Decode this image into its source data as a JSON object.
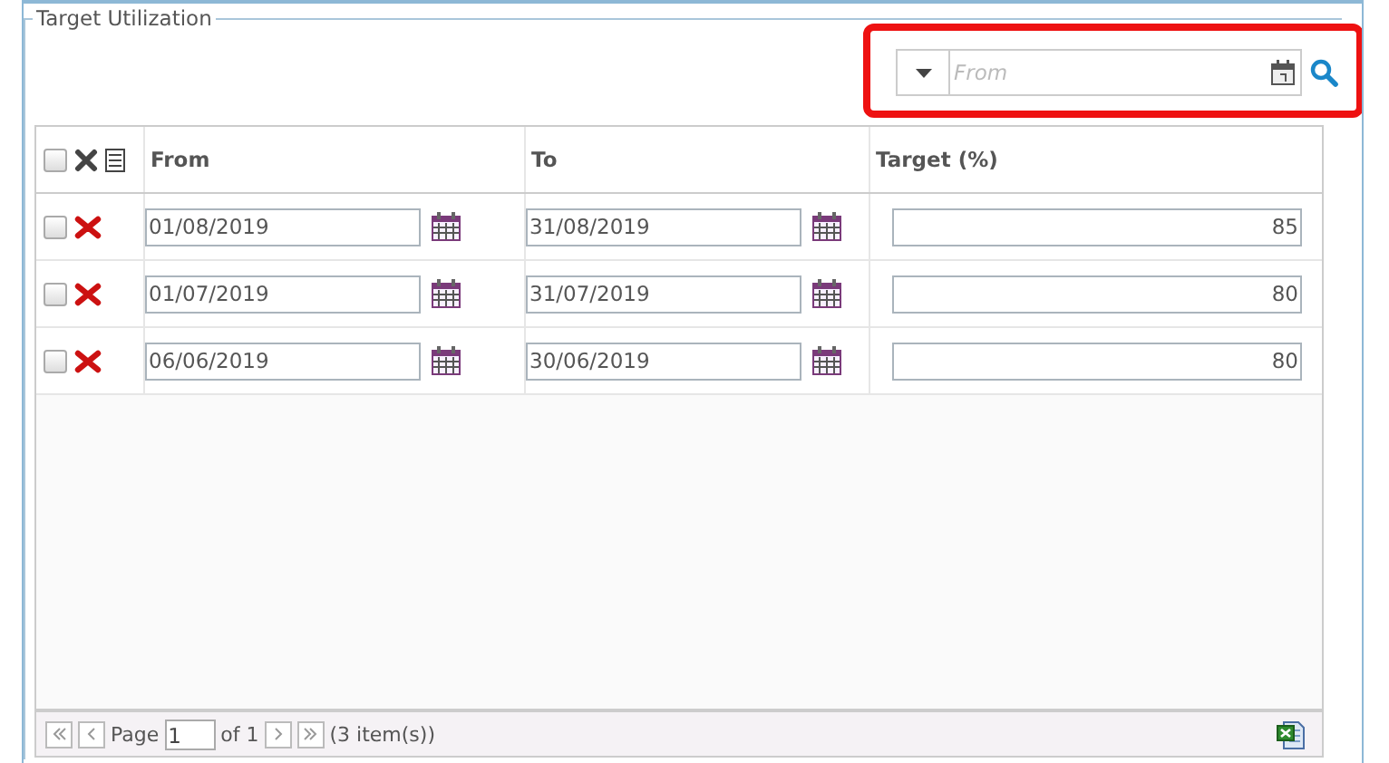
{
  "panel": {
    "title": "Target Utilization"
  },
  "filter": {
    "placeholder": "From",
    "highlighted": true
  },
  "table": {
    "columns": [
      "From",
      "To",
      "Target (%)"
    ],
    "select_all": {
      "checked": false
    },
    "rows": [
      {
        "checked": false,
        "from": "01/08/2019",
        "to": "31/08/2019",
        "target": "85"
      },
      {
        "checked": false,
        "from": "01/07/2019",
        "to": "31/07/2019",
        "target": "80"
      },
      {
        "checked": false,
        "from": "06/06/2019",
        "to": "30/06/2019",
        "target": "80"
      }
    ]
  },
  "pager": {
    "page_label": "Page",
    "page": "1",
    "of_label": "of 1",
    "count": "(3 item(s))"
  }
}
